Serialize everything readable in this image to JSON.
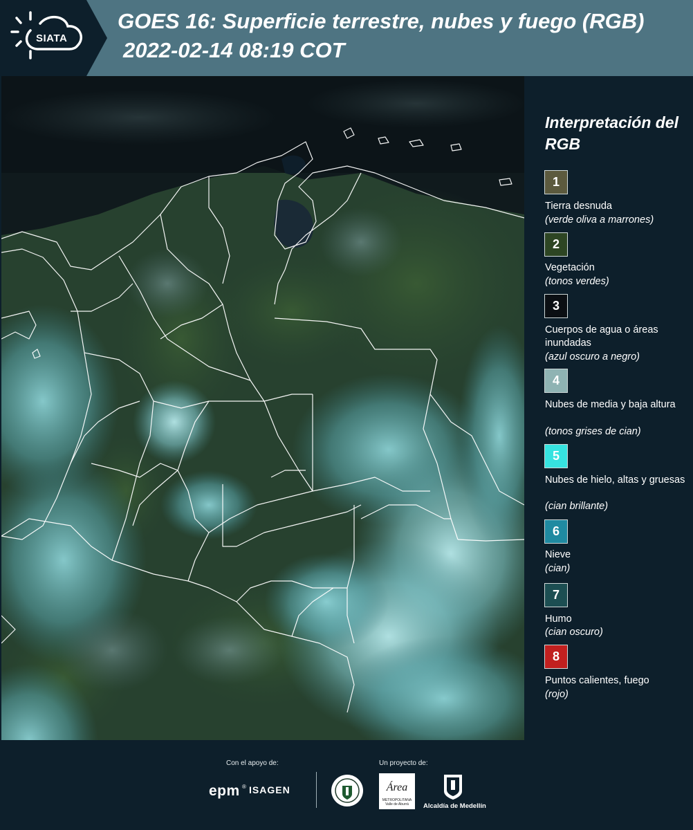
{
  "header": {
    "logo_text": "SIATA",
    "title": "GOES 16: Superficie terrestre, nubes y fuego (RGB)",
    "subtitle": "2022-02-14 08:19 COT",
    "bar_color": "#4e7482"
  },
  "legend": {
    "title": "Interpretación del RGB",
    "items": [
      {
        "number": "1",
        "label": "Tierra desnuda",
        "note": "(verde oliva a marrones)",
        "color": "#5c5a3e"
      },
      {
        "number": "2",
        "label": "Vegetación",
        "note": "(tonos verdes)",
        "color": "#2d4523"
      },
      {
        "number": "3",
        "label": "Cuerpos de agua o áreas inundadas",
        "note": "(azul oscuro a negro)",
        "color": "#0b0f13"
      },
      {
        "number": "4",
        "label": "Nubes de media y baja altura",
        "note": "(tonos grises de cian)",
        "color": "#8fb3b3"
      },
      {
        "number": "5",
        "label": "Nubes de hielo, altas y gruesas",
        "note": "(cian brillante)",
        "color": "#36e3e0"
      },
      {
        "number": "6",
        "label": "Nieve",
        "note": "(cian)",
        "color": "#1f8aa1"
      },
      {
        "number": "7",
        "label": "Humo",
        "note": "(cian oscuro)",
        "color": "#1c4e52"
      },
      {
        "number": "8",
        "label": "Puntos calientes, fuego",
        "note": "(rojo)",
        "color": "#c1201f"
      }
    ]
  },
  "footer": {
    "support_caption": "Con el apoyo de:",
    "project_caption": "Un proyecto de:",
    "sponsor_1": "epm",
    "sponsor_2": "ISAGEN",
    "area_logo": "Área",
    "area_sub": "METROPOLITANA Valle de Aburrá",
    "alcaldia": "Alcaldía de Medellín"
  },
  "map": {
    "icon": "satellite-rgb-map",
    "colors": {
      "ocean": "#0c1619",
      "vegetation": "#2c4a30",
      "cloud": "#6fb8bd",
      "border": "#ffffff"
    }
  }
}
